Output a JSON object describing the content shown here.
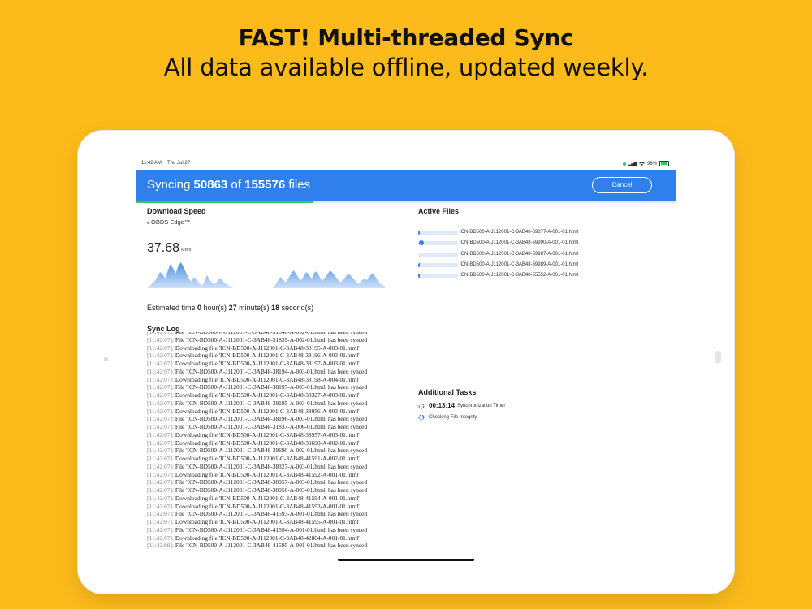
{
  "hero": {
    "title": "FAST! Multi-threaded Sync",
    "subtitle": "All data available offline, updated weekly."
  },
  "status_bar": {
    "time": "11:42 AM",
    "date": "Thu Jul 27",
    "battery": "96%"
  },
  "header": {
    "prefix": "Syncing ",
    "synced": "50863",
    "of": " of ",
    "total": "155576",
    "suffix": " files",
    "cancel_label": "Cancel",
    "progress_percent": 32.7,
    "accent_color": "#2f80ed",
    "progress_color": "#34c759"
  },
  "download": {
    "heading": "Download Speed",
    "source": "OBDS Edge™",
    "speed_value": "37.68",
    "speed_unit": "MB/s"
  },
  "estimate": {
    "label": "Estimated time ",
    "hours": "0",
    "hours_label": " hour(s) ",
    "minutes": "27",
    "minutes_label": " minute(s) ",
    "seconds": "18",
    "seconds_label": " second(s)"
  },
  "sync_log": {
    "heading": "Sync Log",
    "entries": [
      {
        "ts": "[11:42:07]:",
        "msg": "File 'ICN-BD500-A-J112001-C-3AB48-31840-A-002-01.html' has been synced"
      },
      {
        "ts": "[11:42:07]:",
        "msg": "File 'ICN-BD500-A-J112001-C-3AB48-31839-A-002-01.html' has been synced"
      },
      {
        "ts": "[11:42:07]:",
        "msg": "Downloading file 'ICN-BD500-A-J112001-C-3AB48-38195-A-003-01.html'"
      },
      {
        "ts": "[11:42:07]:",
        "msg": "Downloading file 'ICN-BD500-A-J112001-C-3AB48-38196-A-003-01.html'"
      },
      {
        "ts": "[11:42:07]:",
        "msg": "Downloading file 'ICN-BD500-A-J112001-C-3AB48-38197-A-003-01.html'"
      },
      {
        "ts": "[11:42:07]:",
        "msg": "File 'ICN-BD500-A-J112001-C-3AB48-38194-A-003-01.html' has been synced"
      },
      {
        "ts": "[11:42:07]:",
        "msg": "Downloading file 'ICN-BD500-A-J112001-C-3AB48-38198-A-004-01.html'"
      },
      {
        "ts": "[11:42:07]:",
        "msg": "File 'ICN-BD500-A-J112001-C-3AB48-38197-A-003-01.html' has been synced"
      },
      {
        "ts": "[11:42:07]:",
        "msg": "Downloading file 'ICN-BD500-A-J112001-C-3AB48-38327-A-003-01.html'"
      },
      {
        "ts": "[11:42:07]:",
        "msg": "File 'ICN-BD500-A-J112001-C-3AB48-38195-A-003-01.html' has been synced"
      },
      {
        "ts": "[11:42:07]:",
        "msg": "Downloading file 'ICN-BD500-A-J112001-C-3AB48-38956-A-003-01.html'"
      },
      {
        "ts": "[11:42:07]:",
        "msg": "File 'ICN-BD500-A-J112001-C-3AB48-38196-A-003-01.html' has been synced"
      },
      {
        "ts": "[11:42:07]:",
        "msg": "File 'ICN-BD500-A-J112001-C-3AB48-31837-A-006-01.html' has been synced"
      },
      {
        "ts": "[11:42:07]:",
        "msg": "Downloading file 'ICN-BD500-A-J112001-C-3AB48-38957-A-003-01.html'"
      },
      {
        "ts": "[11:42:07]:",
        "msg": "Downloading file 'ICN-BD500-A-J112001-C-3AB48-39690-A-002-01.html'"
      },
      {
        "ts": "[11:42:07]:",
        "msg": "File 'ICN-BD500-A-J112001-C-3AB48-39690-A-002-01.html' has been synced"
      },
      {
        "ts": "[11:42:07]:",
        "msg": "Downloading file 'ICN-BD500-A-J112001-C-3AB48-41591-A-002-01.html'"
      },
      {
        "ts": "[11:42:07]:",
        "msg": "File 'ICN-BD500-A-J112001-C-3AB48-38327-A-003-01.html' has been synced"
      },
      {
        "ts": "[11:42:07]:",
        "msg": "Downloading file 'ICN-BD500-A-J112001-C-3AB48-41592-A-001-01.html'"
      },
      {
        "ts": "[11:42:07]:",
        "msg": "File 'ICN-BD500-A-J112001-C-3AB48-38957-A-003-01.html' has been synced"
      },
      {
        "ts": "[11:42:07]:",
        "msg": "File 'ICN-BD500-A-J112001-C-3AB48-38956-A-003-01.html' has been synced"
      },
      {
        "ts": "[11:42:07]:",
        "msg": "Downloading file 'ICN-BD500-A-J112001-C-3AB48-41594-A-001-01.html'"
      },
      {
        "ts": "[11:42:07]:",
        "msg": "Downloading file 'ICN-BD500-A-J112001-C-3AB48-41593-A-001-01.html'"
      },
      {
        "ts": "[11:42:07]:",
        "msg": "File 'ICN-BD500-A-J112001-C-3AB48-41593-A-001-01.html' has been synced"
      },
      {
        "ts": "[11:42:07]:",
        "msg": "Downloading file 'ICN-BD500-A-J112001-C-3AB48-41595-A-001-01.html'"
      },
      {
        "ts": "[11:42:07]:",
        "msg": "File 'ICN-BD500-A-J112001-C-3AB48-41594-A-001-01.html' has been synced"
      },
      {
        "ts": "[11:42:07]:",
        "msg": "Downloading file 'ICN-BD500-A-J112001-C-3AB48-42804-A-001-01.html'"
      },
      {
        "ts": "[11:42:08]:",
        "msg": "File 'ICN-BD500-A-J112001-C-3AB48-41595-A-001-01.html' has been synced"
      }
    ]
  },
  "active_files": {
    "heading": "Active Files",
    "items": [
      {
        "name": "ICN-BD500-A-J112001-C-3AB48-59877-A-001-01.html",
        "progress": 0.05,
        "style": "bar"
      },
      {
        "name": "ICN-BD500-A-J112001-C-3AB48-59990-A-001-01.html",
        "progress": 0.1,
        "style": "dot"
      },
      {
        "name": "ICN-BD500-A-J112001-C-3AB48-59987-A-001-01.html",
        "progress": 0.0,
        "style": "bar"
      },
      {
        "name": "ICN-BD500-A-J112001-C-3AB48-59989-A-001-01.html",
        "progress": 0.04,
        "style": "bar"
      },
      {
        "name": "ICN-BD500-A-J112001-C-3AB48-55552-A-001-01.html",
        "progress": 0.04,
        "style": "bar"
      }
    ]
  },
  "additional_tasks": {
    "heading": "Additional Tasks",
    "items": [
      {
        "value": "00:13:14",
        "label": "Synchronization Timer"
      },
      {
        "value": "",
        "label": "Checking File Integrity"
      }
    ]
  },
  "speed_chart": {
    "samples": [
      0,
      3,
      6,
      9,
      14,
      20,
      17,
      12,
      22,
      30,
      24,
      18,
      28,
      32,
      26,
      19,
      12,
      8,
      14,
      10,
      6,
      3,
      8,
      16,
      10,
      7,
      5,
      9,
      13,
      9,
      6,
      4,
      2,
      0,
      0,
      0,
      0,
      0,
      0,
      0,
      0,
      0,
      0,
      0,
      0,
      0,
      0,
      0,
      0,
      4,
      9,
      14,
      11,
      7,
      12,
      17,
      22,
      18,
      13,
      10,
      15,
      20,
      16,
      12,
      19,
      21,
      14,
      9,
      13,
      17,
      22,
      19,
      15,
      11,
      7,
      10,
      14,
      18,
      15,
      12,
      8,
      5,
      9,
      12,
      10,
      14,
      18,
      16,
      11,
      7,
      4,
      3
    ]
  }
}
